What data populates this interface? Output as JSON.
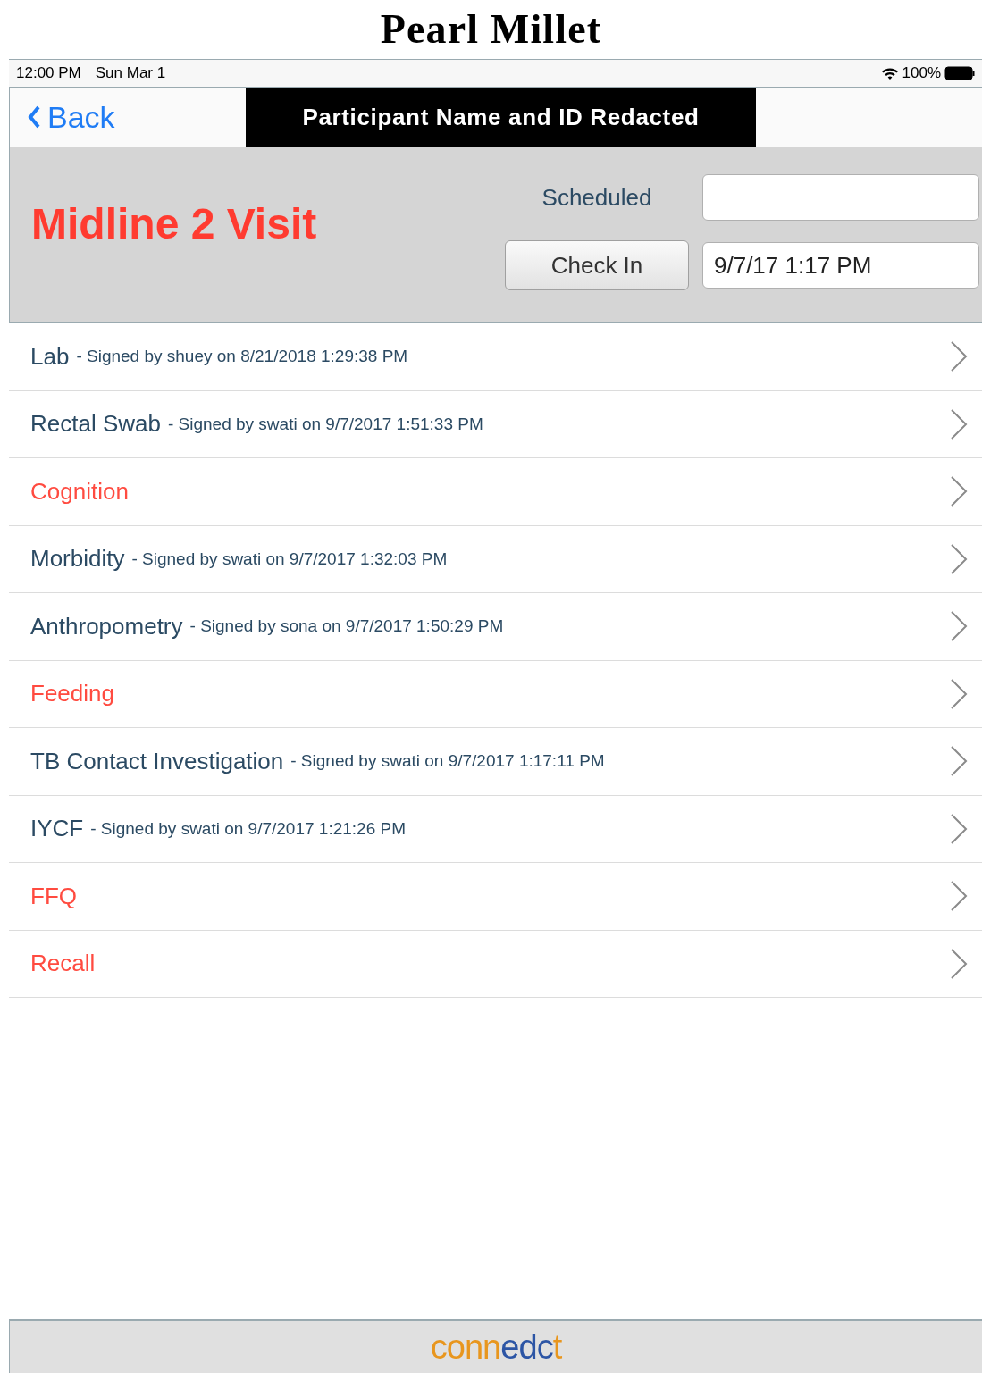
{
  "page_title": "Pearl Millet",
  "status_bar": {
    "time": "12:00 PM",
    "date": "Sun Mar 1",
    "battery": "100%"
  },
  "nav": {
    "back": "Back",
    "title": "Participant Name and ID Redacted"
  },
  "visit": {
    "title": "Midline 2 Visit",
    "scheduled_label": "Scheduled",
    "check_in": "Check In",
    "check_in_value": "9/7/17 1:17 PM"
  },
  "forms": [
    {
      "name": "Lab",
      "completed": true,
      "signature": "- Signed by shuey on 8/21/2018 1:29:38 PM"
    },
    {
      "name": "Rectal Swab",
      "completed": true,
      "signature": "- Signed by swati on 9/7/2017 1:51:33 PM"
    },
    {
      "name": "Cognition",
      "completed": false
    },
    {
      "name": "Morbidity",
      "completed": true,
      "signature": "- Signed by swati on 9/7/2017 1:32:03 PM"
    },
    {
      "name": "Anthropometry",
      "completed": true,
      "signature": "- Signed by sona on 9/7/2017 1:50:29 PM"
    },
    {
      "name": "Feeding",
      "completed": false
    },
    {
      "name": "TB Contact Investigation",
      "completed": true,
      "signature": "- Signed by swati on 9/7/2017 1:17:11 PM"
    },
    {
      "name": "IYCF",
      "completed": true,
      "signature": "- Signed by swati on 9/7/2017 1:21:26 PM"
    },
    {
      "name": "FFQ",
      "completed": false
    },
    {
      "name": "Recall",
      "completed": false
    }
  ],
  "footer_logo": [
    {
      "text": "conn",
      "color": "#e8961e"
    },
    {
      "text": "edc",
      "color": "#2c55a5"
    },
    {
      "text": "t",
      "color": "#e8961e"
    }
  ]
}
